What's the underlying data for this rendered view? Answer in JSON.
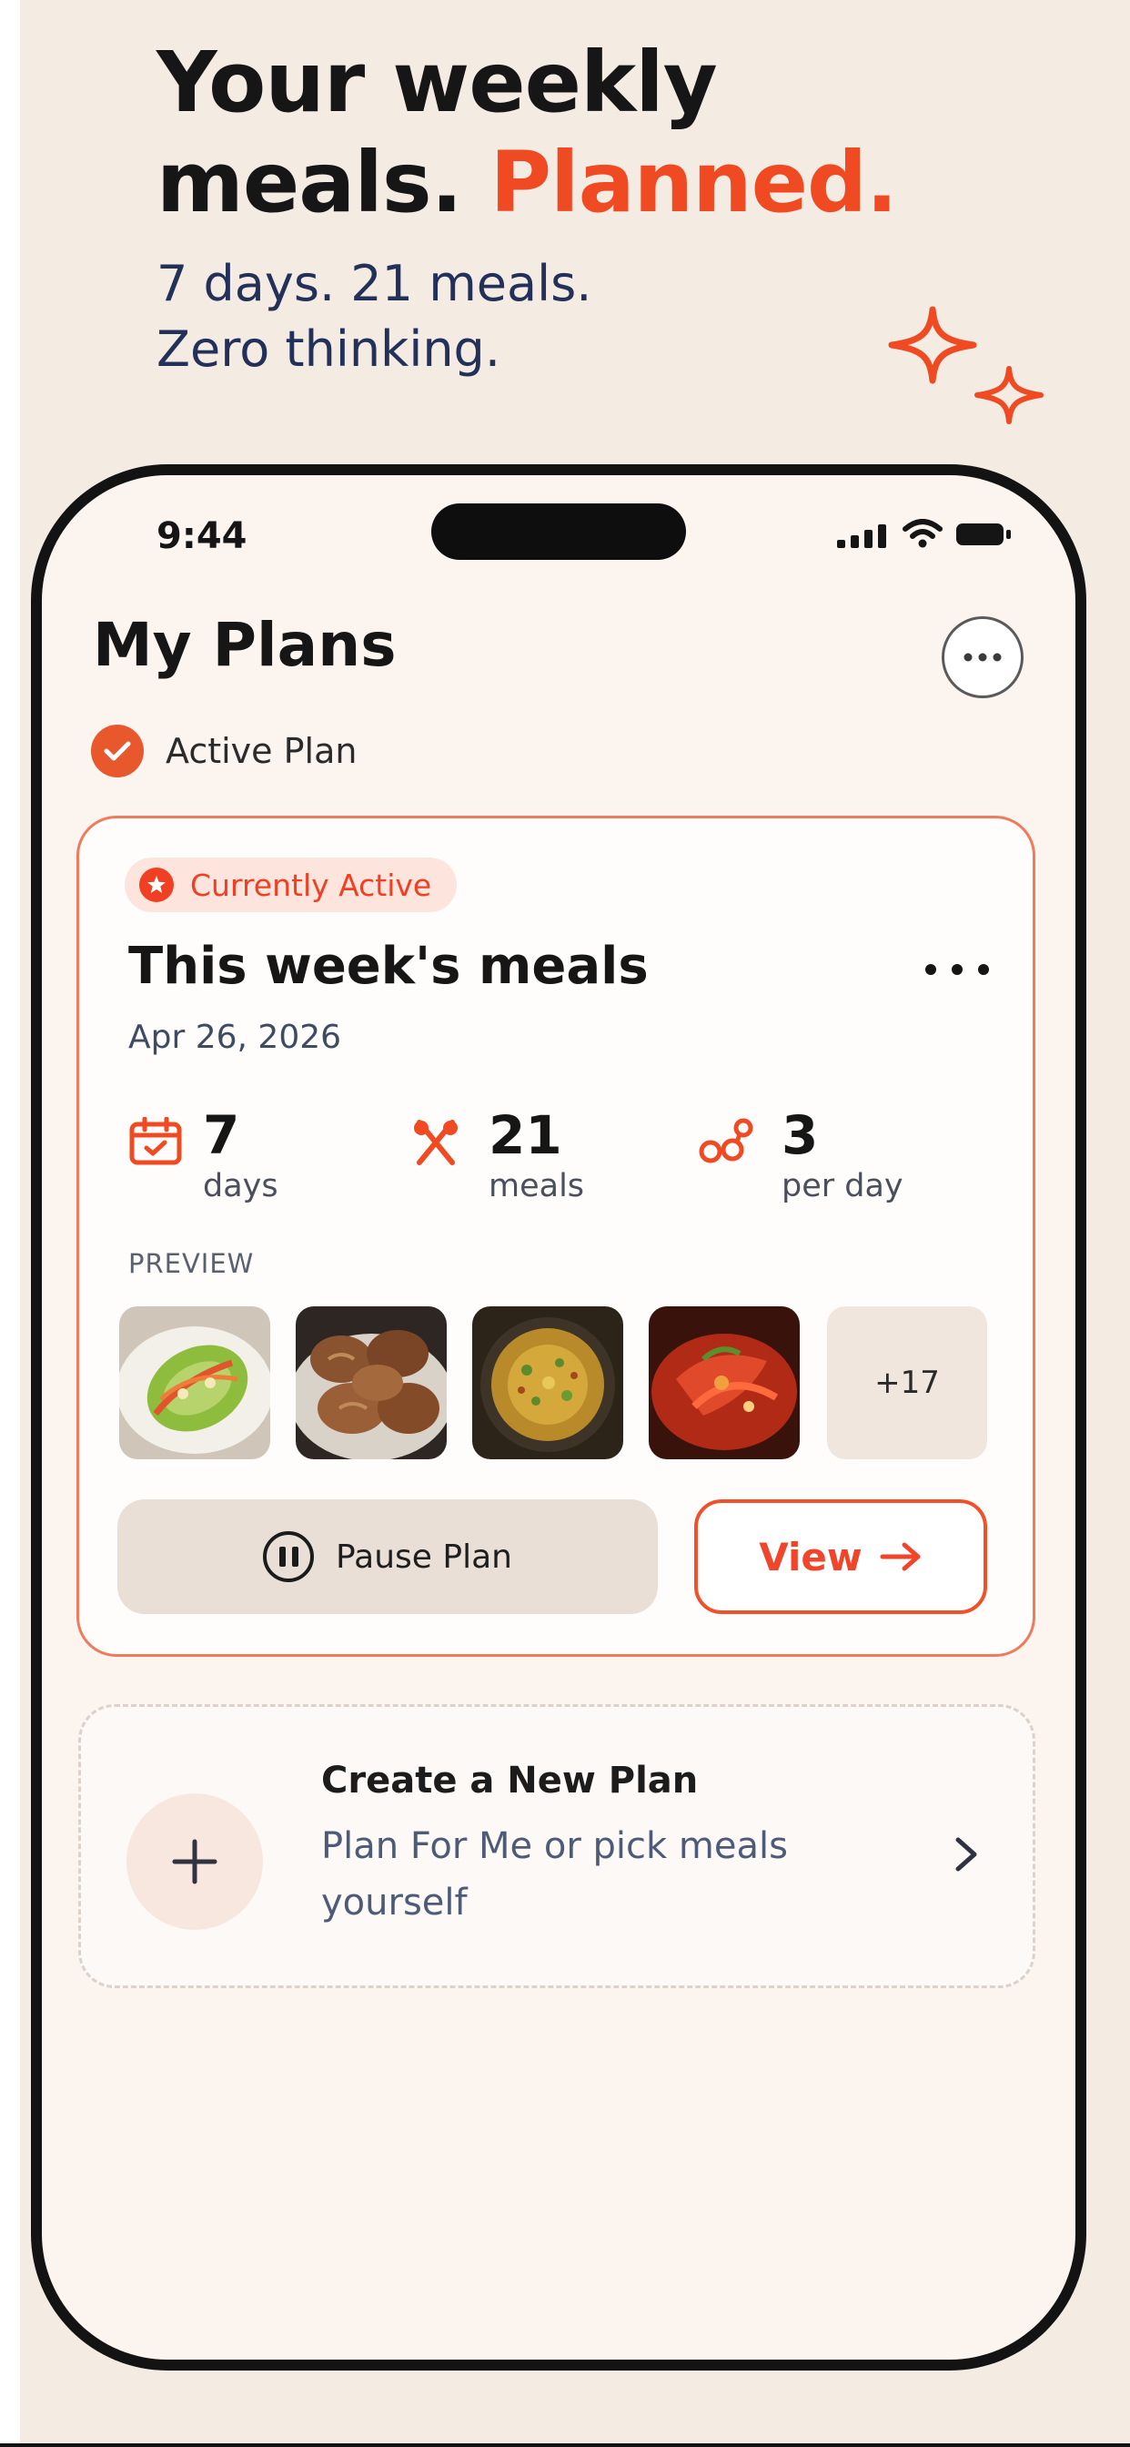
{
  "hero": {
    "line1": "Your weekly",
    "line2_a": "meals.",
    "line2_b": "Planned.",
    "sub1": "7 days. 21 meals.",
    "sub2": "Zero thinking."
  },
  "status_bar": {
    "time": "9:44",
    "icons": [
      "signal-icon",
      "wifi-icon",
      "battery-icon"
    ]
  },
  "header": {
    "title": "My Plans",
    "more_icon": "more-horizontal-icon"
  },
  "section": {
    "label": "Active Plan",
    "icon": "check-circle-icon"
  },
  "active_plan": {
    "badge": "Currently Active",
    "title": "This week's meals",
    "date": "Apr 26, 2026",
    "stats": [
      {
        "value": "7",
        "label": "days",
        "icon": "calendar-icon"
      },
      {
        "value": "21",
        "label": "meals",
        "icon": "utensils-icon"
      },
      {
        "value": "3",
        "label": "per day",
        "icon": "meal-count-icon"
      }
    ],
    "preview_label": "PREVIEW",
    "preview_more": "+17",
    "pause_label": "Pause Plan",
    "view_label": "View"
  },
  "new_plan": {
    "title": "Create a New Plan",
    "subtitle": "Plan For Me or pick meals yourself"
  },
  "colors": {
    "accent": "#f04a23",
    "navy": "#23305a",
    "background": "#f4ebe3",
    "screen": "#fbf4ef"
  }
}
